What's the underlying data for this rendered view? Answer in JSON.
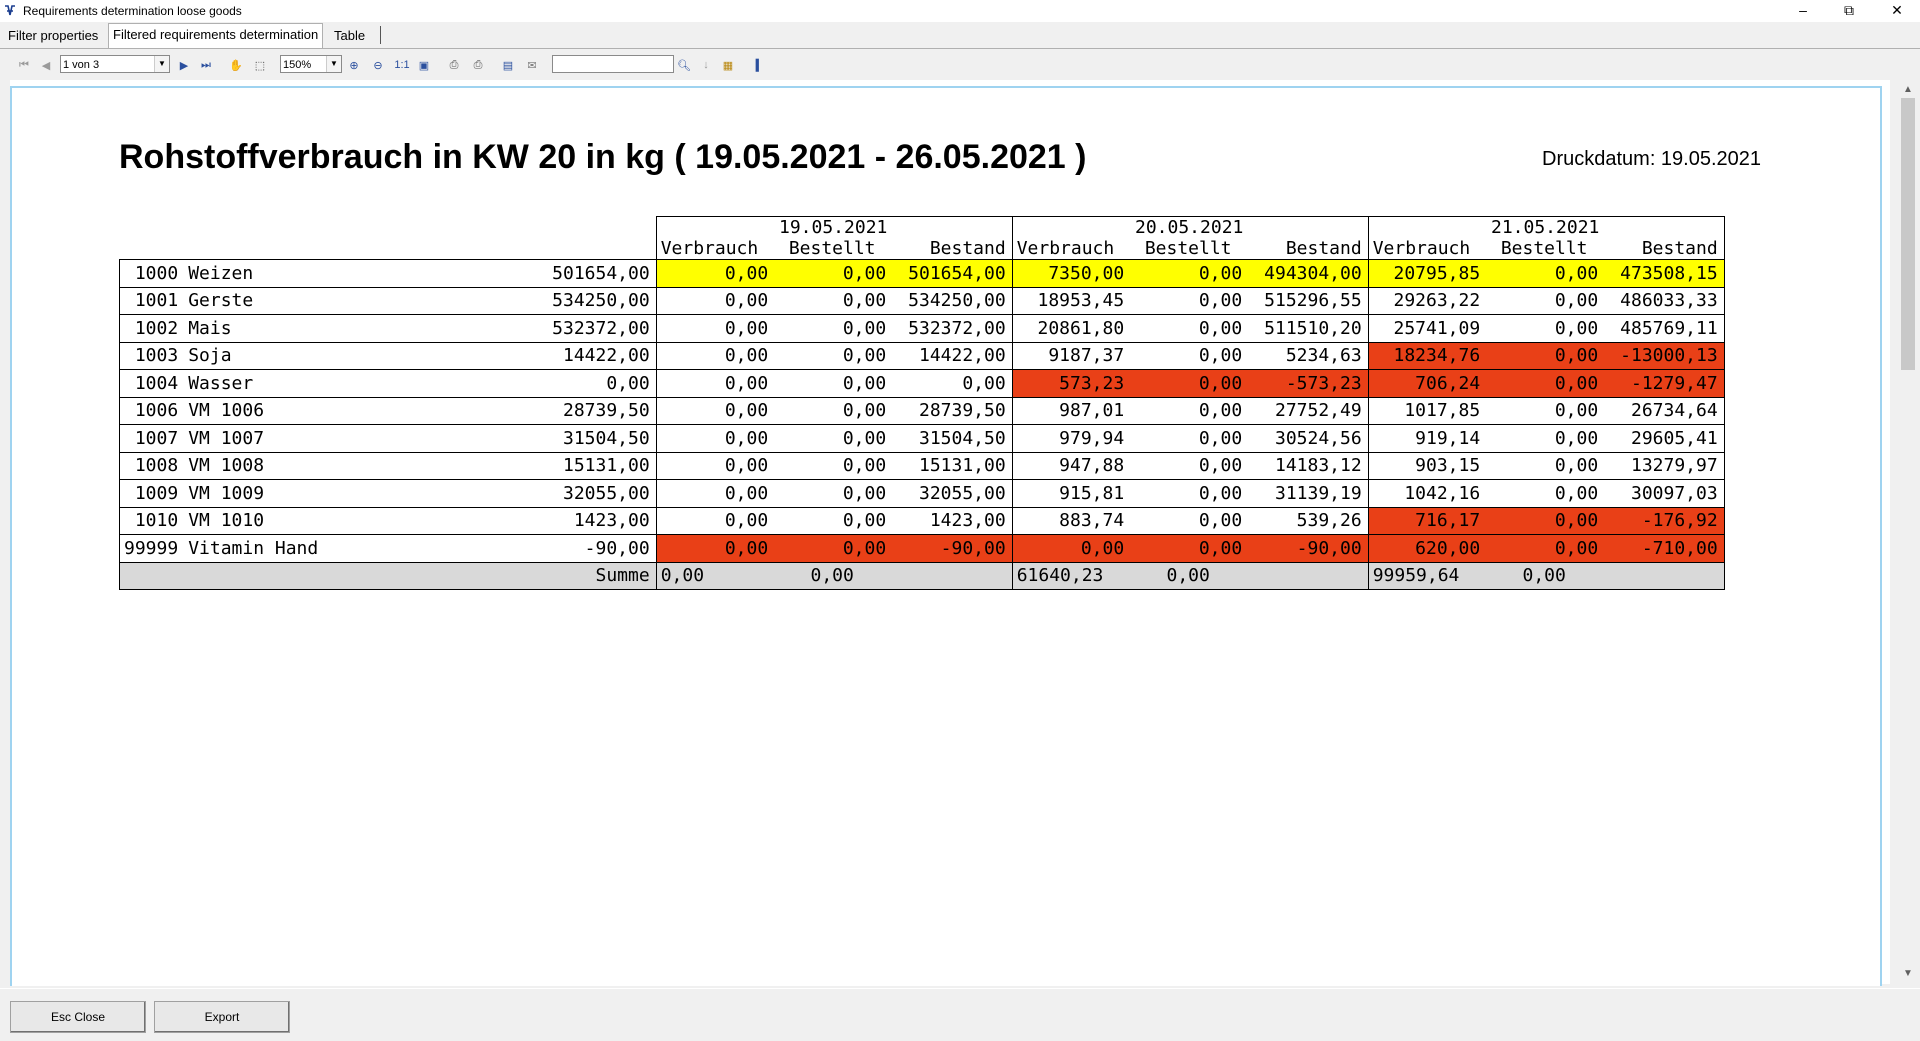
{
  "window": {
    "title": "Requirements determination loose goods"
  },
  "tabs": [
    {
      "label": "Filter properties"
    },
    {
      "label": "Filtered requirements determination"
    },
    {
      "label": "Table"
    }
  ],
  "toolbar": {
    "page_value": "1 von 3",
    "zoom_value": "150%",
    "one_to_one": "1:1",
    "search_value": ""
  },
  "report": {
    "title": "Rohstoffverbrauch in KW 20 in kg ( 19.05.2021 - 26.05.2021 )",
    "print_date_label": "Druckdatum: 19.05.2021",
    "dates": [
      "19.05.2021",
      "20.05.2021",
      "21.05.2021"
    ],
    "sub_headers": [
      "Verbrauch",
      "Bestellt",
      "Bestand"
    ],
    "rows": [
      {
        "code": "1000",
        "name": "Weizen",
        "stock": "501654,00",
        "cells": [
          "0,00",
          "0,00",
          "501654,00",
          "7350,00",
          "0,00",
          "494304,00",
          "20795,85",
          "0,00",
          "473508,15"
        ]
      },
      {
        "code": "1001",
        "name": "Gerste",
        "stock": "534250,00",
        "cells": [
          "0,00",
          "0,00",
          "534250,00",
          "18953,45",
          "0,00",
          "515296,55",
          "29263,22",
          "0,00",
          "486033,33"
        ]
      },
      {
        "code": "1002",
        "name": "Mais",
        "stock": "532372,00",
        "cells": [
          "0,00",
          "0,00",
          "532372,00",
          "20861,80",
          "0,00",
          "511510,20",
          "25741,09",
          "0,00",
          "485769,11"
        ]
      },
      {
        "code": "1003",
        "name": "Soja",
        "stock": "14422,00",
        "cells": [
          "0,00",
          "0,00",
          "14422,00",
          "9187,37",
          "0,00",
          "5234,63",
          "18234,76",
          "0,00",
          "-13000,13"
        ]
      },
      {
        "code": "1004",
        "name": "Wasser",
        "stock": "0,00",
        "cells": [
          "0,00",
          "0,00",
          "0,00",
          "573,23",
          "0,00",
          "-573,23",
          "706,24",
          "0,00",
          "-1279,47"
        ]
      },
      {
        "code": "1006",
        "name": "VM 1006",
        "stock": "28739,50",
        "cells": [
          "0,00",
          "0,00",
          "28739,50",
          "987,01",
          "0,00",
          "27752,49",
          "1017,85",
          "0,00",
          "26734,64"
        ]
      },
      {
        "code": "1007",
        "name": "VM 1007",
        "stock": "31504,50",
        "cells": [
          "0,00",
          "0,00",
          "31504,50",
          "979,94",
          "0,00",
          "30524,56",
          "919,14",
          "0,00",
          "29605,41"
        ]
      },
      {
        "code": "1008",
        "name": "VM 1008",
        "stock": "15131,00",
        "cells": [
          "0,00",
          "0,00",
          "15131,00",
          "947,88",
          "0,00",
          "14183,12",
          "903,15",
          "0,00",
          "13279,97"
        ]
      },
      {
        "code": "1009",
        "name": "VM 1009",
        "stock": "32055,00",
        "cells": [
          "0,00",
          "0,00",
          "32055,00",
          "915,81",
          "0,00",
          "31139,19",
          "1042,16",
          "0,00",
          "30097,03"
        ]
      },
      {
        "code": "1010",
        "name": "VM 1010",
        "stock": "1423,00",
        "cells": [
          "0,00",
          "0,00",
          "1423,00",
          "883,74",
          "0,00",
          "539,26",
          "716,17",
          "0,00",
          "-176,92"
        ]
      },
      {
        "code": "99999",
        "name": "Vitamin Hand",
        "stock": "-90,00",
        "cells": [
          "0,00",
          "0,00",
          "-90,00",
          "0,00",
          "0,00",
          "-90,00",
          "620,00",
          "0,00",
          "-710,00"
        ]
      }
    ],
    "sum_label": "Summe",
    "sum_cells": [
      "0,00",
      "0,00",
      "",
      "61640,23",
      "0,00",
      "",
      "99959,64",
      "0,00",
      ""
    ],
    "highlight_colors": {
      "yellow": "#ffff00",
      "red": "#e94017"
    }
  },
  "buttons": {
    "close": "Esc Close",
    "export": "Export"
  }
}
